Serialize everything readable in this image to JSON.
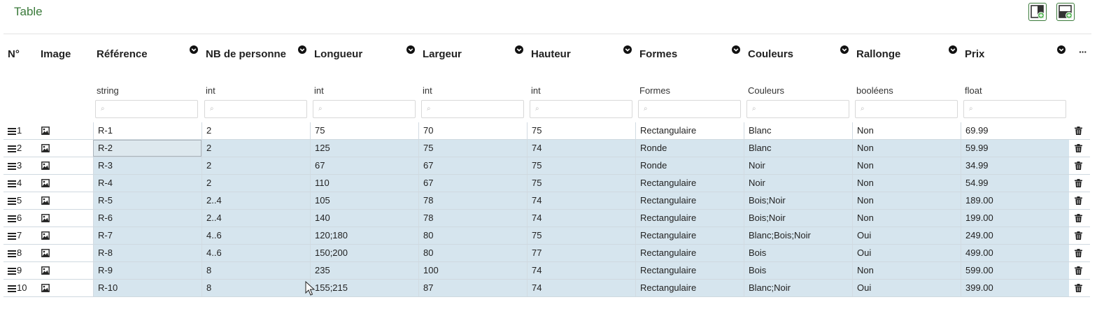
{
  "header": {
    "title": "Table"
  },
  "toolbar": {
    "add_column_icon": "add-column-icon",
    "add_row_icon": "add-row-icon",
    "accent": "#3a7a3a"
  },
  "columns": {
    "num": "N°",
    "image": "Image",
    "more": "···",
    "items": [
      {
        "label": "Référence",
        "type": "string"
      },
      {
        "label": "NB de personne",
        "type": "int"
      },
      {
        "label": "Longueur",
        "type": "int"
      },
      {
        "label": "Largeur",
        "type": "int"
      },
      {
        "label": "Hauteur",
        "type": "int"
      },
      {
        "label": "Formes",
        "type": "Formes"
      },
      {
        "label": "Couleurs",
        "type": "Couleurs"
      },
      {
        "label": "Rallonge",
        "type": "booléens"
      },
      {
        "label": "Prix",
        "type": "float"
      }
    ]
  },
  "rows": [
    {
      "n": "1",
      "cells": [
        "R-1",
        "2",
        "75",
        "70",
        "75",
        "Rectangulaire",
        "Blanc",
        "Non",
        "69.99"
      ]
    },
    {
      "n": "2",
      "cells": [
        "R-2",
        "2",
        "125",
        "75",
        "74",
        "Ronde",
        "Blanc",
        "Non",
        "59.99"
      ]
    },
    {
      "n": "3",
      "cells": [
        "R-3",
        "2",
        "67",
        "67",
        "75",
        "Ronde",
        "Noir",
        "Non",
        "34.99"
      ]
    },
    {
      "n": "4",
      "cells": [
        "R-4",
        "2",
        "110",
        "67",
        "75",
        "Rectangulaire",
        "Noir",
        "Non",
        "54.99"
      ]
    },
    {
      "n": "5",
      "cells": [
        "R-5",
        "2..4",
        "105",
        "78",
        "74",
        "Rectangulaire",
        "Bois;Noir",
        "Non",
        "189.00"
      ]
    },
    {
      "n": "6",
      "cells": [
        "R-6",
        "2..4",
        "140",
        "78",
        "74",
        "Rectangulaire",
        "Bois;Noir",
        "Non",
        "199.00"
      ]
    },
    {
      "n": "7",
      "cells": [
        "R-7",
        "4..6",
        "120;180",
        "80",
        "75",
        "Rectangulaire",
        "Blanc;Bois;Noir",
        "Oui",
        "249.00"
      ]
    },
    {
      "n": "8",
      "cells": [
        "R-8",
        "4..6",
        "150;200",
        "80",
        "77",
        "Rectangulaire",
        "Bois",
        "Oui",
        "499.00"
      ]
    },
    {
      "n": "9",
      "cells": [
        "R-9",
        "8",
        "235",
        "100",
        "74",
        "Rectangulaire",
        "Bois",
        "Non",
        "599.00"
      ]
    },
    {
      "n": "10",
      "cells": [
        "R-10",
        "8",
        "155;215",
        "87",
        "74",
        "Rectangulaire",
        "Blanc;Noir",
        "Oui",
        "399.00"
      ]
    }
  ],
  "selection": {
    "selected_rows": [
      2,
      3,
      4,
      5,
      6,
      7,
      8,
      9,
      10
    ],
    "active_cell": "R-2"
  }
}
